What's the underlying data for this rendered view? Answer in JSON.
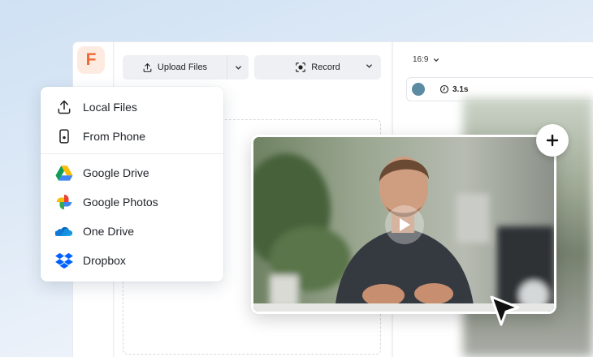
{
  "app": {
    "logo_letter": "F",
    "accent": "#f06a35"
  },
  "toolbar": {
    "upload_label": "Upload Files",
    "record_label": "Record"
  },
  "right_panel": {
    "aspect_ratio": "16:9",
    "duration": "3.1s",
    "clip_color": "#5d8aa3"
  },
  "upload_menu": {
    "items": [
      {
        "label": "Local Files",
        "icon": "upload-icon"
      },
      {
        "label": "From Phone",
        "icon": "phone-icon"
      },
      {
        "label": "Google Drive",
        "icon": "google-drive-icon"
      },
      {
        "label": "Google Photos",
        "icon": "google-photos-icon"
      },
      {
        "label": "One Drive",
        "icon": "onedrive-icon"
      },
      {
        "label": "Dropbox",
        "icon": "dropbox-icon"
      }
    ]
  },
  "video": {
    "icon": "play-icon"
  },
  "actions": {
    "add_icon": "plus-icon",
    "pointer_icon": "cursor-icon"
  }
}
